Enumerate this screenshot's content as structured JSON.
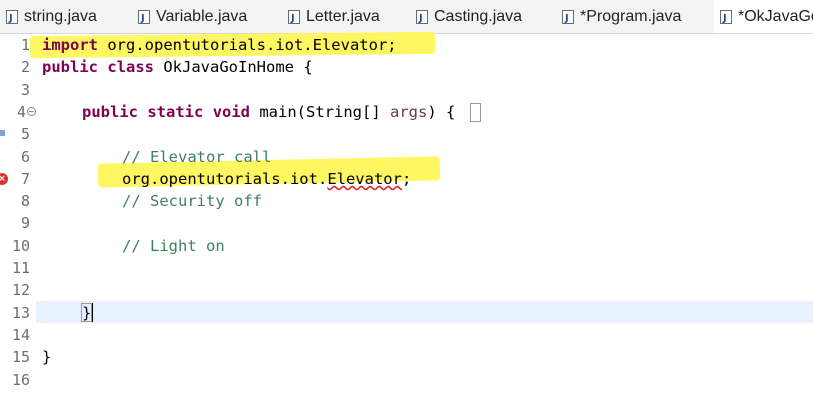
{
  "tabs": [
    {
      "label": "string.java",
      "active": false
    },
    {
      "label": "Variable.java",
      "active": false
    },
    {
      "label": "Letter.java",
      "active": false
    },
    {
      "label": "Casting.java",
      "active": false
    },
    {
      "label": "*Program.java",
      "active": false
    },
    {
      "label": "*OkJavaGo",
      "active": true
    }
  ],
  "line_numbers": [
    "1",
    "2",
    "3",
    "4",
    "5",
    "6",
    "7",
    "8",
    "9",
    "10",
    "11",
    "12",
    "13",
    "14",
    "15",
    "16"
  ],
  "code": {
    "l1_kw": "import",
    "l1_rest": " org.opentutorials.iot.Elevator;",
    "l2_kw1": "public",
    "l2_kw2": "class",
    "l2_rest": " OkJavaGoInHome {",
    "l4_kw1": "public",
    "l4_kw2": "static",
    "l4_kw3": "void",
    "l4_mid": " main(String[] ",
    "l4_param": "args",
    "l4_end": ") {",
    "l6_comment": "// Elevator call",
    "l7_pre": "org.opentutorials.iot.",
    "l7_err": "Elevator",
    "l7_end": ";",
    "l8_comment": "// Security off",
    "l10_comment": "// Light on",
    "l13_brace": "}",
    "l15_brace": "}"
  },
  "colors": {
    "keyword": "#7f0055",
    "comment": "#3f7f5f",
    "highlight": "#fff75a",
    "error": "#d9342b",
    "current_line": "#e8f2fe"
  },
  "icons": {
    "tab": "java-file-icon",
    "fold": "fold-collapse-icon",
    "error": "error-icon"
  }
}
